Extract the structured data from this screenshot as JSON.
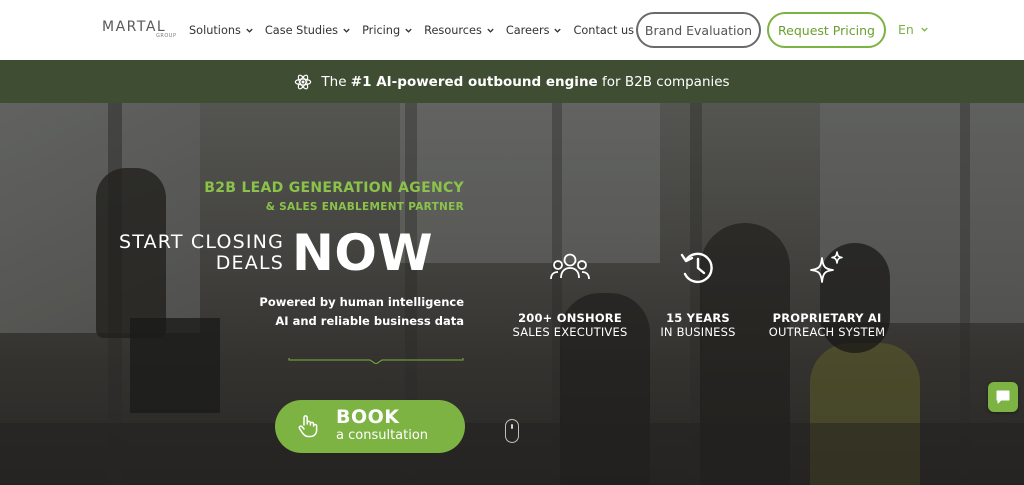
{
  "header": {
    "logo_text": "MARTAL",
    "logo_sub": "GROUP",
    "nav": [
      {
        "label": "Solutions",
        "has_dropdown": true
      },
      {
        "label": "Case Studies",
        "has_dropdown": true
      },
      {
        "label": "Pricing",
        "has_dropdown": true
      },
      {
        "label": "Resources",
        "has_dropdown": true
      },
      {
        "label": "Careers",
        "has_dropdown": true
      },
      {
        "label": "Contact us",
        "has_dropdown": false
      }
    ],
    "brand_eval_label": "Brand Evaluation",
    "request_pricing_label": "Request Pricing",
    "language": "En"
  },
  "banner": {
    "icon": "atom-icon",
    "text_prefix": "The ",
    "text_bold": "#1 AI-powered outbound engine",
    "text_suffix": " for B2B companies"
  },
  "hero": {
    "agency_line1": "B2B LEAD GENERATION AGENCY",
    "agency_line2": "& SALES ENABLEMENT PARTNER",
    "closing_line1": "START CLOSING",
    "closing_line2": "DEALS",
    "now": "NOW",
    "powered_line1": "Powered by human intelligence",
    "powered_line2": "AI and reliable business data",
    "book_main": "BOOK",
    "book_sub": "a consultation"
  },
  "stats": [
    {
      "icon": "team-icon",
      "title": "200+ ONSHORE",
      "sub": "SALES EXECUTIVES"
    },
    {
      "icon": "history-clock-icon",
      "title": "15 YEARS",
      "sub": "IN BUSINESS"
    },
    {
      "icon": "sparkles-icon",
      "title": "PROPRIETARY AI",
      "sub": "OUTREACH SYSTEM"
    }
  ],
  "colors": {
    "accent_green": "#7cb342",
    "banner_bg": "#3f4e33",
    "header_bg": "#ffffff"
  }
}
